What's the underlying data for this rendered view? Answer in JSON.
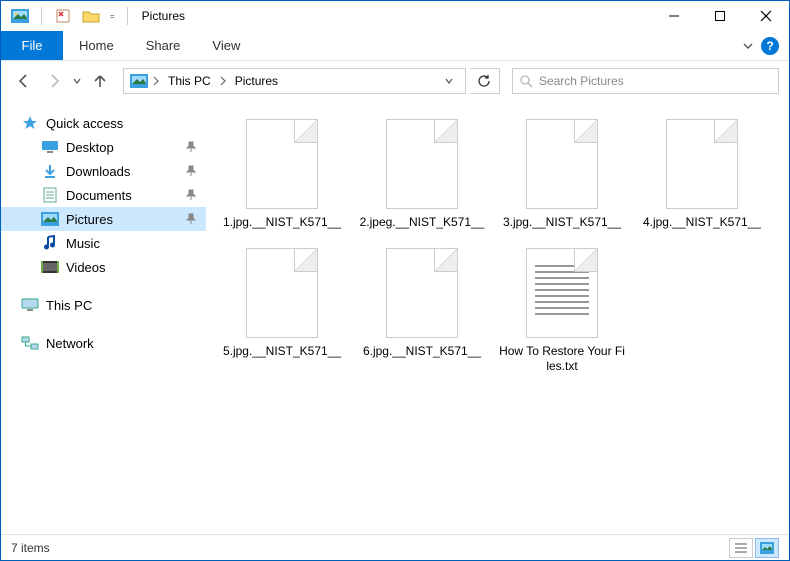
{
  "window": {
    "title": "Pictures"
  },
  "ribbon": {
    "file": "File",
    "tabs": [
      "Home",
      "Share",
      "View"
    ]
  },
  "nav": {
    "breadcrumbs": [
      "This PC",
      "Pictures"
    ],
    "search_placeholder": "Search Pictures"
  },
  "sidebar": {
    "quick_access": "Quick access",
    "items": [
      {
        "label": "Desktop",
        "icon": "desktop",
        "pinned": true
      },
      {
        "label": "Downloads",
        "icon": "downloads",
        "pinned": true
      },
      {
        "label": "Documents",
        "icon": "documents",
        "pinned": true
      },
      {
        "label": "Pictures",
        "icon": "pictures",
        "pinned": true,
        "selected": true
      },
      {
        "label": "Music",
        "icon": "music",
        "pinned": false
      },
      {
        "label": "Videos",
        "icon": "videos",
        "pinned": false
      }
    ],
    "this_pc": "This PC",
    "network": "Network"
  },
  "files": [
    {
      "name": "1.jpg.__NIST_K571__",
      "type": "blank"
    },
    {
      "name": "2.jpeg.__NIST_K571__",
      "type": "blank"
    },
    {
      "name": "3.jpg.__NIST_K571__",
      "type": "blank"
    },
    {
      "name": "4.jpg.__NIST_K571__",
      "type": "blank"
    },
    {
      "name": "5.jpg.__NIST_K571__",
      "type": "blank"
    },
    {
      "name": "6.jpg.__NIST_K571__",
      "type": "blank"
    },
    {
      "name": "How To Restore Your Files.txt",
      "type": "text"
    }
  ],
  "status": {
    "count_label": "7 items"
  }
}
